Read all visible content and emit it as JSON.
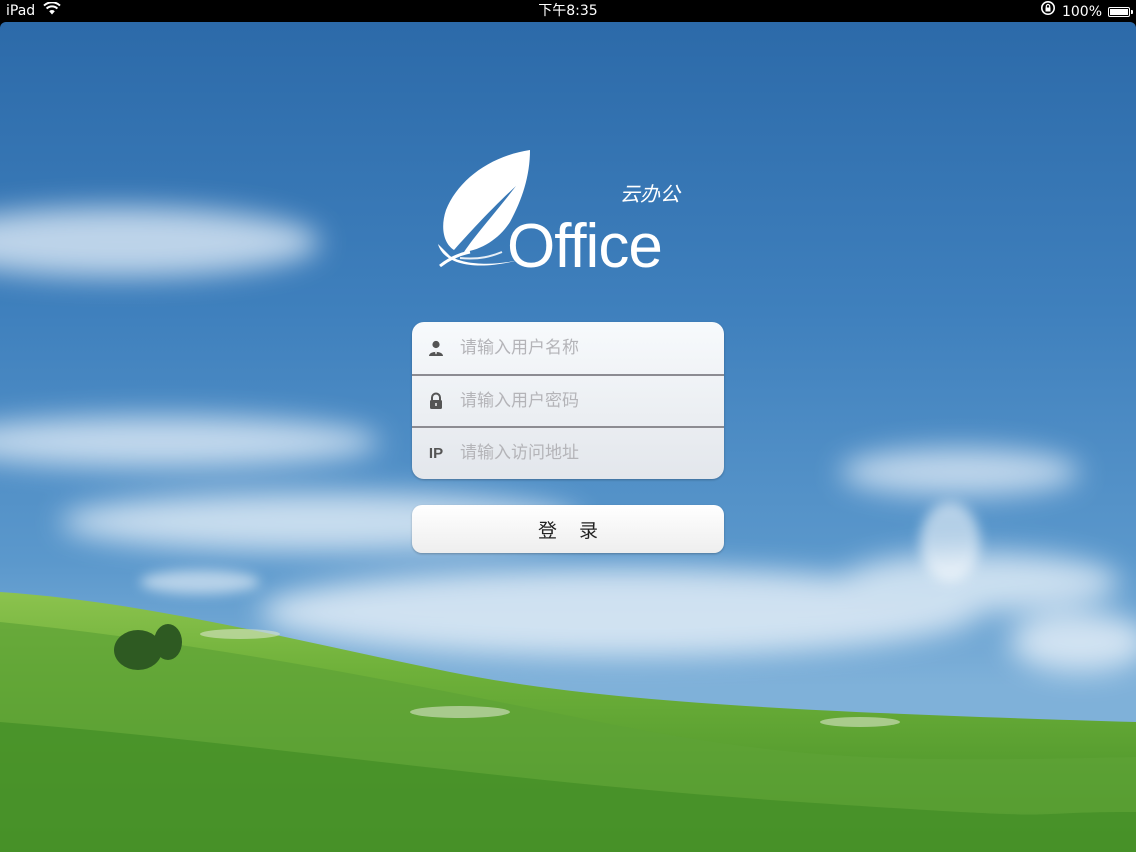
{
  "status_bar": {
    "device": "iPad",
    "time": "下午8:35",
    "battery_text": "100%",
    "battery_level": 1.0
  },
  "logo": {
    "wordmark": "Office",
    "tagline": "云办公",
    "icon": "feather-icon"
  },
  "form": {
    "username": {
      "icon": "user-icon",
      "placeholder": "请输入用户名称",
      "value": ""
    },
    "password": {
      "icon": "lock-icon",
      "placeholder": "请输入用户密码",
      "value": ""
    },
    "server": {
      "icon_text": "IP",
      "placeholder": "请输入访问地址",
      "value": ""
    }
  },
  "login_button": {
    "label": "登 录"
  },
  "colors": {
    "sky_top": "#2f6fae",
    "sky_mid": "#4f8fc6",
    "grass": "#5fa43a",
    "placeholder": "#b4b4b8"
  }
}
